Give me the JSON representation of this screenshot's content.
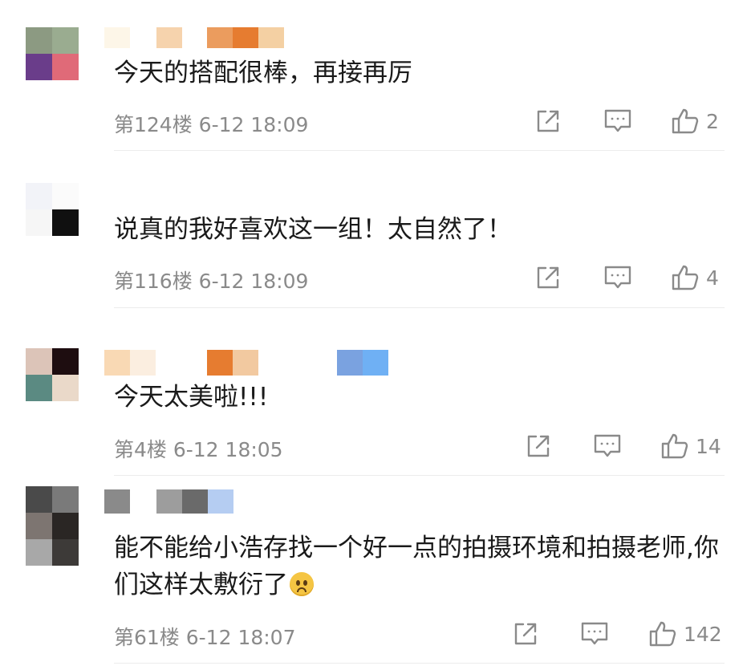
{
  "colors": {
    "text": "#1a1a1a",
    "meta": "#8a8a8a",
    "icon": "#8a8a8a",
    "divider": "#ececec",
    "background": "#ffffff"
  },
  "comments": [
    {
      "avatar_colors": [
        "#8c9a82",
        "#9aac90",
        "#6a3d8a",
        "#e06a78"
      ],
      "username_blur_colors": [
        "#fdf6e8",
        "#f6d3ad",
        "#eb9c5e",
        "#e67c30",
        "#f4d0a3"
      ],
      "text": "今天的搭配很棒，再接再厉",
      "meta": "第124楼 6-12 18:09",
      "likes": "2",
      "icons": [
        "share-icon",
        "comment-icon",
        "like-icon"
      ]
    },
    {
      "avatar_colors": [
        "#f2f3f8",
        "#fbfbfb",
        "#f6f6f6",
        "#101010"
      ],
      "username_blur_colors": [],
      "text": "说真的我好喜欢这一组！太自然了！",
      "meta": "第116楼 6-12 18:09",
      "likes": "4",
      "icons": [
        "share-icon",
        "comment-icon",
        "like-icon"
      ]
    },
    {
      "avatar_colors": [
        "#dcc4b8",
        "#1e0d10",
        "#5b8a82",
        "#ead9c9"
      ],
      "username_blur_colors": [
        "#f9d9b4",
        "#fbeee0",
        "#e67c30",
        "#f2c9a0",
        "#7aa2e0",
        "#6fb0f4"
      ],
      "text": "今天太美啦!!!",
      "meta": "第4楼 6-12 18:05",
      "likes": "14",
      "icons": [
        "share-icon",
        "comment-icon",
        "like-icon"
      ]
    },
    {
      "avatar_colors": [
        "#4a4a4a",
        "#7a7a7a",
        "#7d7571",
        "#2a2624",
        "#a8a8a8",
        "#3d3a38"
      ],
      "username_blur_colors": [
        "#8a8a8a",
        "#9d9d9d",
        "#6a6a6a",
        "#b5cdf2"
      ],
      "text": "能不能给小浩存找一个好一点的拍摄环境和拍摄老师,你们这样太敷衍了",
      "meta": "第61楼 6-12 18:07",
      "likes": "142",
      "icons": [
        "share-icon",
        "comment-icon",
        "like-icon"
      ],
      "emoji": "worried-face-emoji"
    }
  ]
}
